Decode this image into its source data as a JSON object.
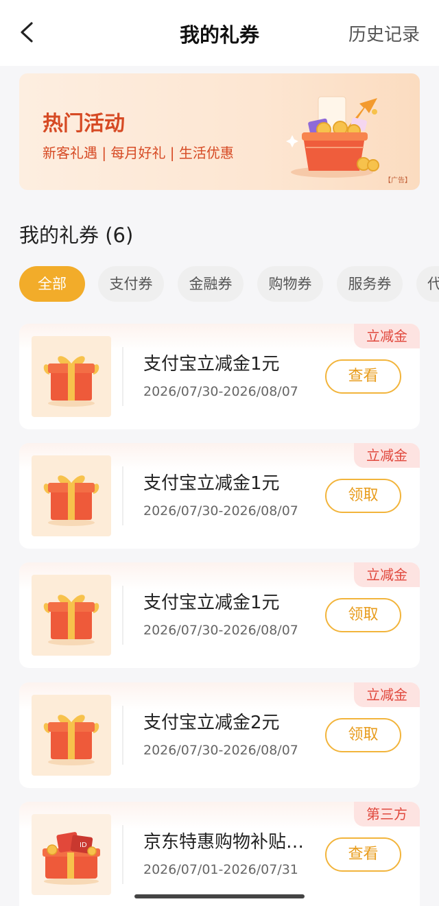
{
  "header": {
    "back_icon": "chevron-left-icon",
    "title": "我的礼券",
    "history_label": "历史记录"
  },
  "banner": {
    "title": "热门活动",
    "subtitle": "新客礼遇 | 每月好礼 | 生活优惠",
    "ad_label": "【广告】"
  },
  "section": {
    "title": "我的礼券 (6)"
  },
  "tabs": [
    {
      "label": "全部",
      "active": true
    },
    {
      "label": "支付券",
      "active": false
    },
    {
      "label": "金融券",
      "active": false
    },
    {
      "label": "购物券",
      "active": false
    },
    {
      "label": "服务券",
      "active": false
    },
    {
      "label": "代",
      "active": false
    }
  ],
  "coupons": [
    {
      "title": "支付宝立减金1元",
      "date": "2026/07/30-2026/08/07",
      "button": "查看",
      "tag": "立减金",
      "icon": "gift-box-icon"
    },
    {
      "title": "支付宝立减金1元",
      "date": "2026/07/30-2026/08/07",
      "button": "领取",
      "tag": "立减金",
      "icon": "gift-box-icon"
    },
    {
      "title": "支付宝立减金1元",
      "date": "2026/07/30-2026/08/07",
      "button": "领取",
      "tag": "立减金",
      "icon": "gift-box-icon"
    },
    {
      "title": "支付宝立减金2元",
      "date": "2026/07/30-2026/08/07",
      "button": "领取",
      "tag": "立减金",
      "icon": "gift-box-icon"
    },
    {
      "title": "京东特惠购物补贴…",
      "date": "2026/07/01-2026/07/31",
      "button": "查看",
      "tag": "第三方",
      "icon": "shopping-gift-icon"
    }
  ],
  "colors": {
    "accent": "#f2ac2a",
    "banner_text": "#d64a24",
    "tag_text": "#e0473c",
    "tag_bg": "#fde3e1"
  }
}
